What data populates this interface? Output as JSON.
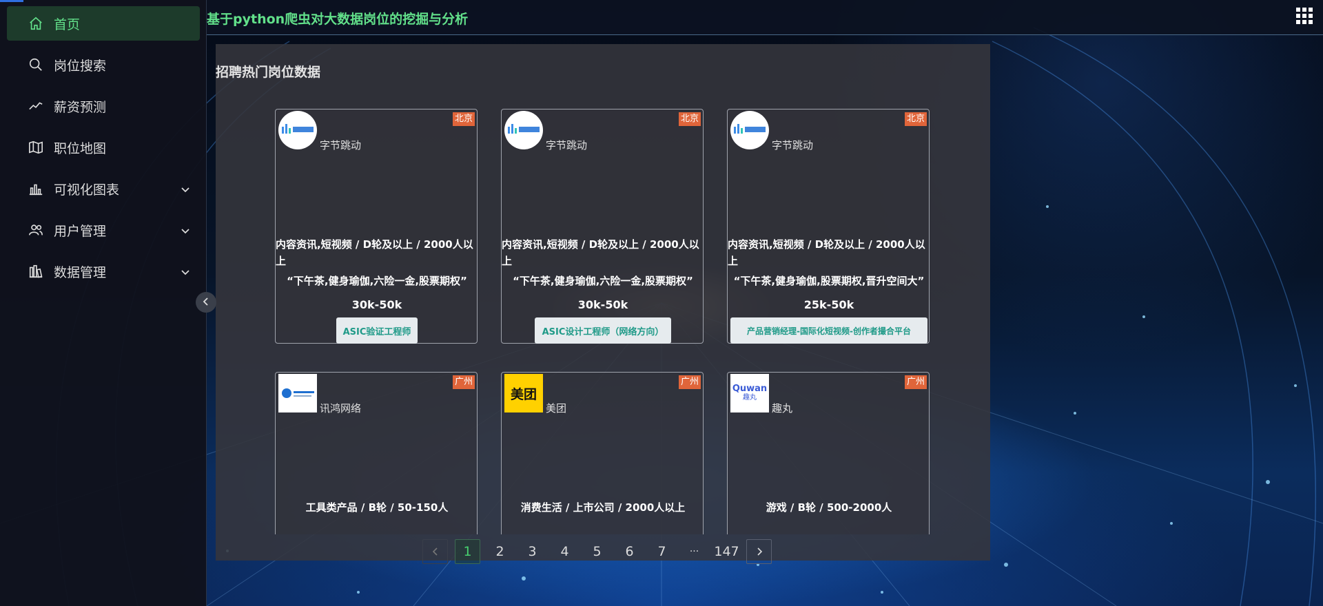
{
  "header": {
    "title": "基于python爬虫对大数据岗位的挖掘与分析"
  },
  "sidebar": {
    "items": [
      {
        "label": "首页",
        "icon": "home-icon",
        "active": true,
        "expandable": false
      },
      {
        "label": "岗位搜索",
        "icon": "search-icon",
        "active": false,
        "expandable": false
      },
      {
        "label": "薪资预测",
        "icon": "trend-line-icon",
        "active": false,
        "expandable": false
      },
      {
        "label": "职位地图",
        "icon": "map-icon",
        "active": false,
        "expandable": false
      },
      {
        "label": "可视化图表",
        "icon": "bar-chart-icon",
        "active": false,
        "expandable": true
      },
      {
        "label": "用户管理",
        "icon": "users-icon",
        "active": false,
        "expandable": true
      },
      {
        "label": "数据管理",
        "icon": "data-icon",
        "active": false,
        "expandable": true
      }
    ]
  },
  "main": {
    "title": "招聘热门岗位数据",
    "cards": [
      {
        "company": "字节跳动",
        "city": "北京",
        "industry": "内容资讯,短视频 / D轮及以上 / 2000人以上",
        "welfare": "“下午茶,健身瑜伽,六险一金,股票期权”",
        "salary": "30k-50k",
        "job": "ASIC验证工程师",
        "logo": "bytedance"
      },
      {
        "company": "字节跳动",
        "city": "北京",
        "industry": "内容资讯,短视频 / D轮及以上 / 2000人以上",
        "welfare": "“下午茶,健身瑜伽,六险一金,股票期权”",
        "salary": "30k-50k",
        "job": "ASIC设计工程师（网络方向）",
        "logo": "bytedance"
      },
      {
        "company": "字节跳动",
        "city": "北京",
        "industry": "内容资讯,短视频 / D轮及以上 / 2000人以上",
        "welfare": "“下午茶,健身瑜伽,股票期权,晋升空间大”",
        "salary": "25k-50k",
        "job": "产品营销经理-国际化短视频-创作者撮合平台",
        "logo": "bytedance"
      },
      {
        "company": "讯鸿网络",
        "city": "广州",
        "industry": "工具类产品 / B轮 / 50-150人",
        "logo": "xunhong"
      },
      {
        "company": "美团",
        "city": "广州",
        "industry": "消费生活 / 上市公司 / 2000人以上",
        "logo": "meituan",
        "logo_text": "美团"
      },
      {
        "company": "趣丸",
        "city": "广州",
        "industry": "游戏 / B轮 / 500-2000人",
        "logo": "quwan",
        "logo_text": "Quwan",
        "logo_sub": "趣丸"
      }
    ]
  },
  "pagination": {
    "pages": [
      "1",
      "2",
      "3",
      "4",
      "5",
      "6",
      "7"
    ],
    "ellipsis": "···",
    "last": "147",
    "current": "1"
  },
  "colors": {
    "accent": "#62e08a",
    "city_badge": "#e0653a",
    "job_tag_text": "#1f9a88"
  }
}
